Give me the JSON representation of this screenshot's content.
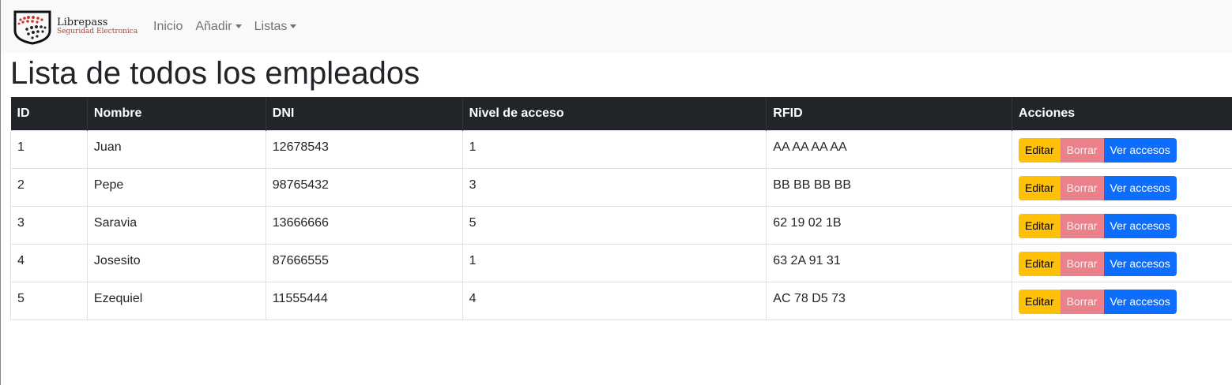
{
  "brand": {
    "name": "Librepass",
    "tagline": "Seguridad Electronica"
  },
  "nav": {
    "inicio": "Inicio",
    "anadir": "Añadir",
    "listas": "Listas"
  },
  "page_title": "Lista de todos los empleados",
  "table": {
    "headers": [
      "ID",
      "Nombre",
      "DNI",
      "Nivel de acceso",
      "RFID",
      "Acciones"
    ],
    "rows": [
      {
        "id": "1",
        "nombre": "Juan",
        "dni": "12678543",
        "nivel": "1",
        "rfid": "AA AA AA AA"
      },
      {
        "id": "2",
        "nombre": "Pepe",
        "dni": "98765432",
        "nivel": "3",
        "rfid": "BB BB BB BB"
      },
      {
        "id": "3",
        "nombre": "Saravia",
        "dni": "13666666",
        "nivel": "5",
        "rfid": "62 19 02 1B"
      },
      {
        "id": "4",
        "nombre": "Josesito",
        "dni": "87666555",
        "nivel": "1",
        "rfid": "63 2A 91 31"
      },
      {
        "id": "5",
        "nombre": "Ezequiel",
        "dni": "11555444",
        "nivel": "4",
        "rfid": "AC 78 D5 73"
      }
    ],
    "actions": {
      "edit": "Editar",
      "delete": "Borrar",
      "view": "Ver accesos"
    }
  },
  "colors": {
    "edit": "#ffc107",
    "delete": "#e9808a",
    "view": "#0d6efd",
    "header_bg": "#212529"
  }
}
